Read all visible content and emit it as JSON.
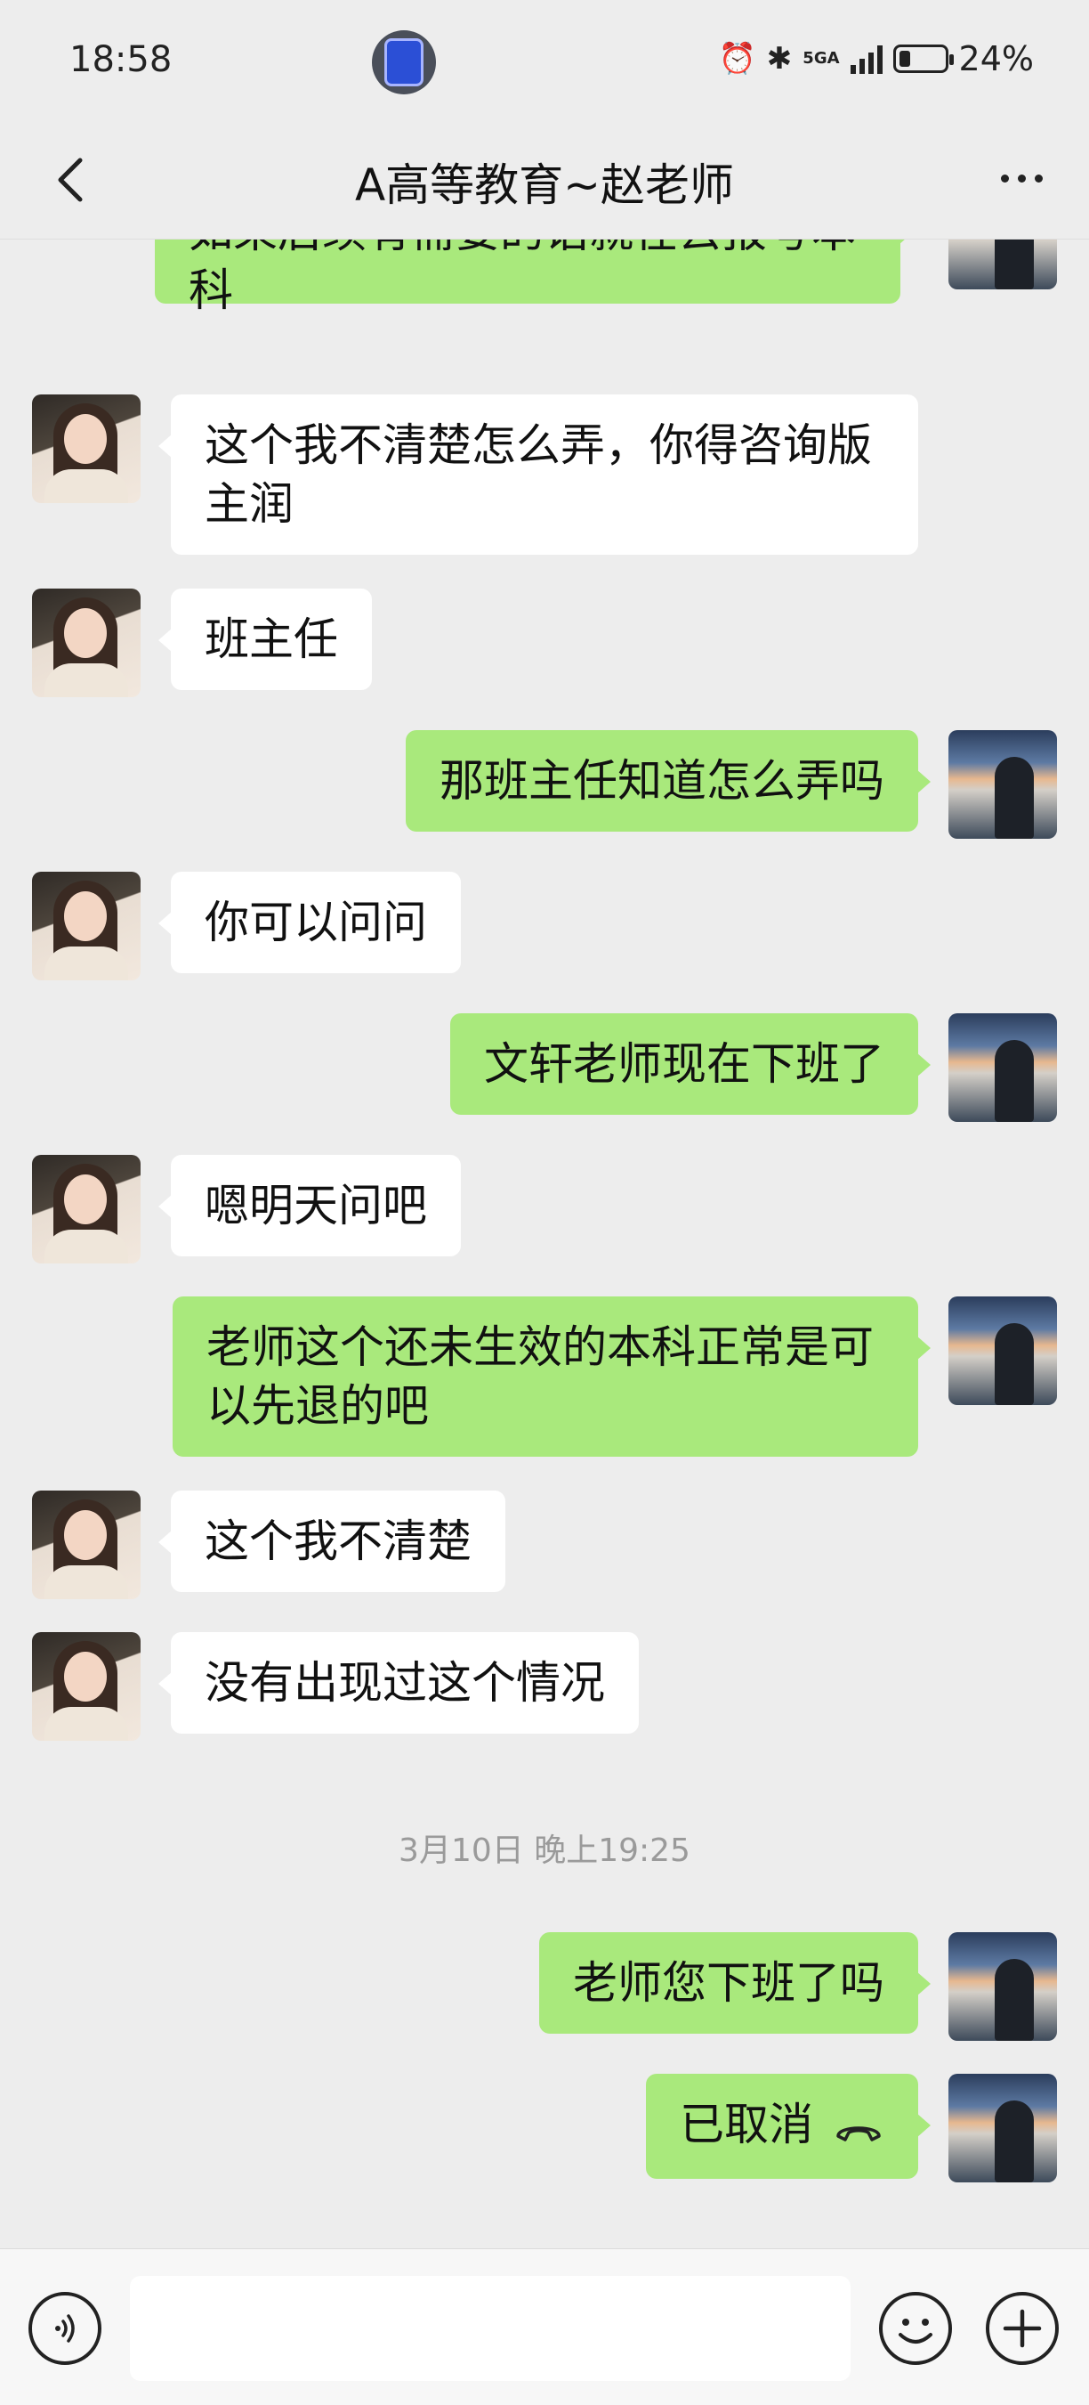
{
  "status_bar": {
    "time": "18:58",
    "network": "5GA",
    "battery_percent": "24%",
    "battery_level": 0.24,
    "icons": [
      "alarm-icon",
      "bluetooth-icon",
      "signal-icon",
      "battery-icon"
    ]
  },
  "header": {
    "title": "A高等教育~赵老师",
    "back_icon": "chevron-left-icon",
    "more_icon": "more-dots-icon"
  },
  "messages": [
    {
      "side": "right",
      "sender": "self",
      "text": "如果后续有需要的话就在去报考本科"
    },
    {
      "side": "left",
      "sender": "teacher",
      "text": "这个我不清楚怎么弄，你得咨询版主润"
    },
    {
      "side": "left",
      "sender": "teacher",
      "text": "班主任"
    },
    {
      "side": "right",
      "sender": "self",
      "text": "那班主任知道怎么弄吗"
    },
    {
      "side": "left",
      "sender": "teacher",
      "text": "你可以问问"
    },
    {
      "side": "right",
      "sender": "self",
      "text": "文轩老师现在下班了"
    },
    {
      "side": "left",
      "sender": "teacher",
      "text": "嗯明天问吧"
    },
    {
      "side": "right",
      "sender": "self",
      "text": "老师这个还未生效的本科正常是可以先退的吧"
    },
    {
      "side": "left",
      "sender": "teacher",
      "text": "这个我不清楚"
    },
    {
      "side": "left",
      "sender": "teacher",
      "text": "没有出现过这个情况"
    },
    {
      "type": "timestamp",
      "text": "3月10日 晚上19:25"
    },
    {
      "side": "right",
      "sender": "self",
      "text": "老师您下班了吗"
    },
    {
      "side": "right",
      "sender": "self",
      "text": "已取消",
      "icon": "hangup-phone-icon"
    }
  ],
  "input_bar": {
    "voice_icon": "voice-icon",
    "input_value": "",
    "emoji_icon": "emoji-icon",
    "plus_icon": "plus-icon"
  },
  "colors": {
    "background": "#ededed",
    "self_bubble": "#a9e97c",
    "other_bubble": "#ffffff"
  }
}
